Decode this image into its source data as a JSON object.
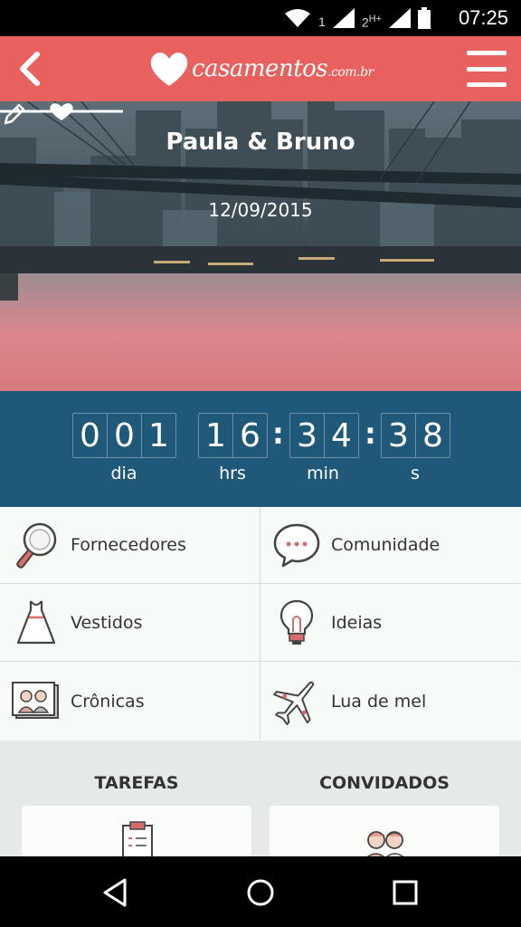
{
  "status_bar": {
    "time": "07:25",
    "sim1_label": "1",
    "sim2_label": "2",
    "network_type": "H+",
    "icons": [
      "wifi-icon",
      "signal-icon",
      "signal-icon",
      "battery-icon"
    ]
  },
  "app_bar": {
    "logo_text": "casamentos",
    "logo_suffix": ".com.br",
    "color": "#e8615f"
  },
  "hero": {
    "couple_names": "Paula & Bruno",
    "wedding_date": "12/09/2015"
  },
  "countdown": {
    "days_digits": [
      "0",
      "0",
      "1"
    ],
    "hours_digits": [
      "1",
      "6"
    ],
    "minutes_digits": [
      "3",
      "4"
    ],
    "seconds_digits": [
      "3",
      "8"
    ],
    "days_label": "dia",
    "hours_label": "hrs",
    "minutes_label": "min",
    "seconds_label": "s",
    "separator": ":",
    "color": "#1f5878"
  },
  "menu_grid": [
    {
      "label": "Fornecedores",
      "icon": "magnifier-icon"
    },
    {
      "label": "Comunidade",
      "icon": "chat-bubble-icon"
    },
    {
      "label": "Vestidos",
      "icon": "dress-icon"
    },
    {
      "label": "Ideias",
      "icon": "lightbulb-icon"
    },
    {
      "label": "Crônicas",
      "icon": "photo-album-icon"
    },
    {
      "label": "Lua de mel",
      "icon": "airplane-icon"
    }
  ],
  "sections": {
    "tasks_title": "TAREFAS",
    "guests_title": "CONVIDADOS"
  }
}
